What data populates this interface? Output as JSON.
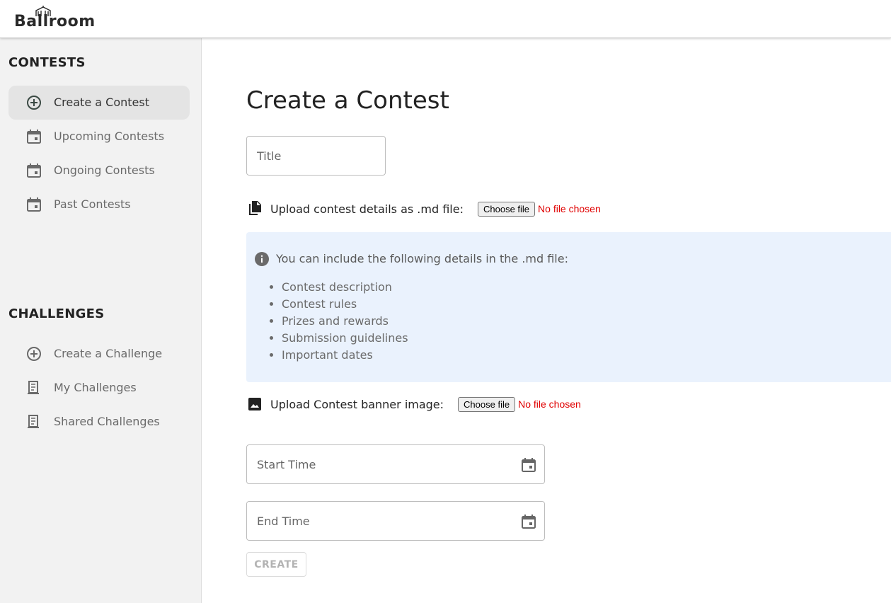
{
  "app": {
    "logo_text": "Ballroom"
  },
  "sidebar": {
    "contests_title": "CONTESTS",
    "contests_items": [
      {
        "label": "Create a Contest",
        "icon": "add-circle-icon",
        "active": true
      },
      {
        "label": "Upcoming Contests",
        "icon": "calendar-icon"
      },
      {
        "label": "Ongoing Contests",
        "icon": "calendar-icon"
      },
      {
        "label": "Past Contests",
        "icon": "calendar-icon"
      }
    ],
    "challenges_title": "CHALLENGES",
    "challenges_items": [
      {
        "label": "Create a Challenge",
        "icon": "add-circle-icon"
      },
      {
        "label": "My Challenges",
        "icon": "receipt-icon"
      },
      {
        "label": "Shared Challenges",
        "icon": "receipt-icon"
      }
    ]
  },
  "main": {
    "title": "Create a Contest",
    "title_field": {
      "placeholder": "Title",
      "value": ""
    },
    "md_upload": {
      "label": "Upload contest details as .md file:",
      "button": "Choose file",
      "status": "No file chosen"
    },
    "info": {
      "text": "You can include the following details in the .md file:",
      "items": [
        "Contest description",
        "Contest rules",
        "Prizes and rewards",
        "Submission guidelines",
        "Important dates"
      ]
    },
    "banner_upload": {
      "label": "Upload Contest banner image:",
      "button": "Choose file",
      "status": "No file chosen"
    },
    "start_time": {
      "placeholder": "Start Time",
      "value": ""
    },
    "end_time": {
      "placeholder": "End Time",
      "value": ""
    },
    "create_button": "CREATE"
  },
  "colors": {
    "error": "#e00000",
    "info_bg": "#eaf2fd",
    "sidebar_bg": "#f2f2f2",
    "active_item_bg": "#e4e4e4"
  }
}
